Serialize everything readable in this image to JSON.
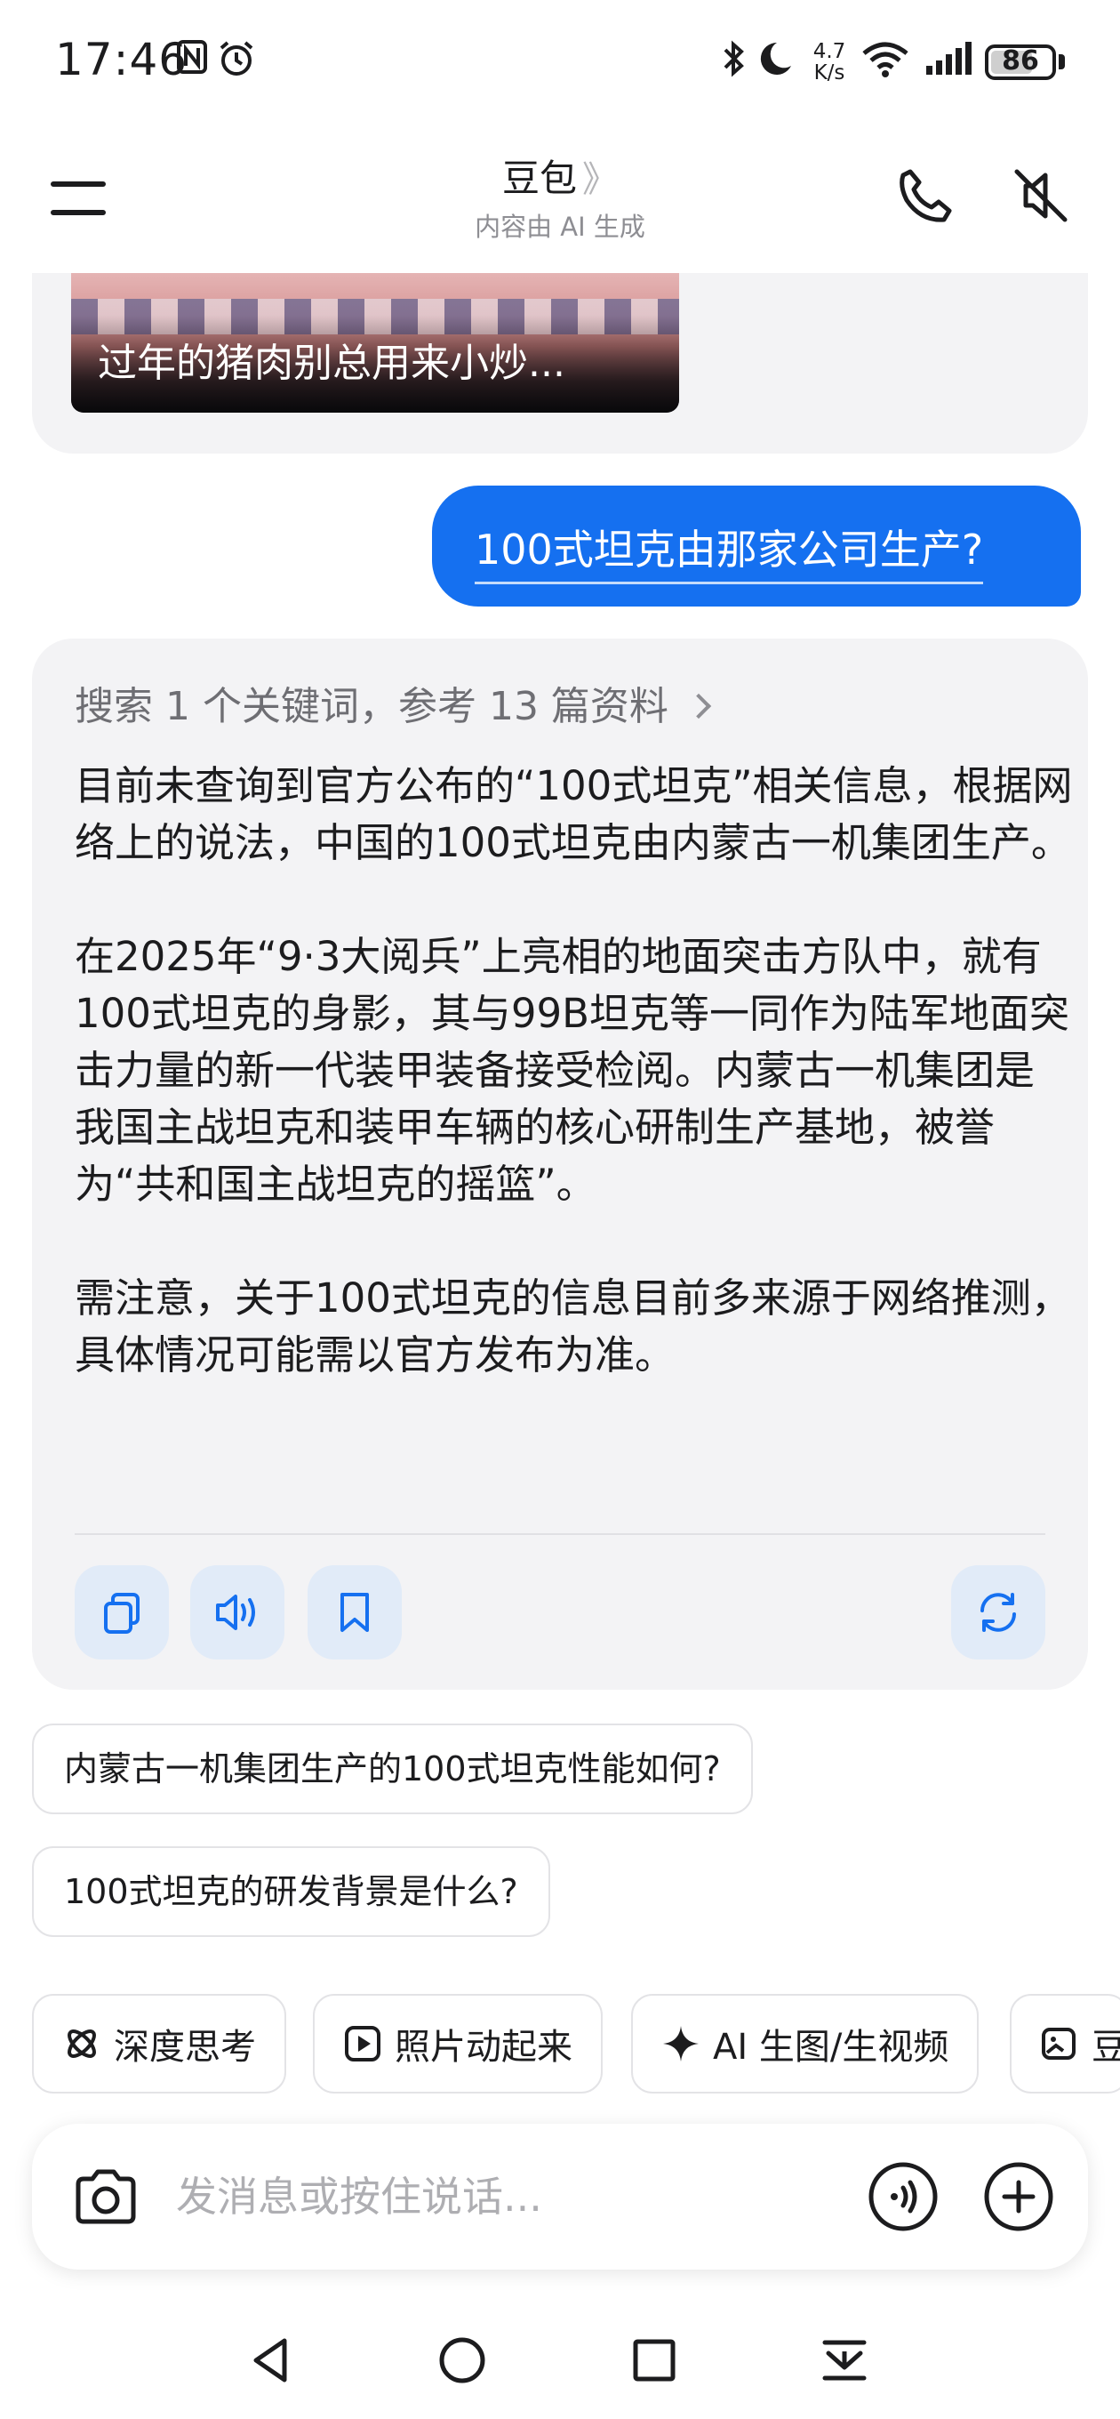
{
  "status_bar": {
    "time": "17:46",
    "speed_value": "4.7",
    "speed_unit": "K/s",
    "battery": "86",
    "battery_level": 0.86
  },
  "header": {
    "title": "豆包",
    "chevron": "》",
    "subtitle": "内容由 AI 生成"
  },
  "previous_message": {
    "thumbnail_caption": "过年的猪肉别总用来小炒..."
  },
  "user_message": "100式坦克由那家公司生产?",
  "answer": {
    "search_summary": "搜索 1 个关键词，参考 13 篇资料",
    "paragraphs": [
      "目前未查询到官方公布的“100式坦克”相关信息，根据网络上的说法，中国的100式坦克由内蒙古一机集团生产。",
      "在2025年“9·3大阅兵”上亮相的地面突击方队中，就有100式坦克的身影，其与99B坦克等一同作为陆军地面突击力量的新一代装甲装备接受检阅。内蒙古一机集团是我国主战坦克和装甲车辆的核心研制生产基地，被誉为“共和国主战坦克的摇篮”。",
      "需注意，关于100式坦克的信息目前多来源于网络推测，具体情况可能需以官方发布为准。"
    ],
    "actions": [
      "copy-icon",
      "speaker-icon",
      "bookmark-icon",
      "regenerate-icon"
    ]
  },
  "suggestions": [
    "内蒙古一机集团生产的100式坦克性能如何?",
    "100式坦克的研发背景是什么?"
  ],
  "feature_chips": [
    {
      "label": "深度思考",
      "icon": "atom-icon"
    },
    {
      "label": "照片动起来",
      "icon": "play-box-icon"
    },
    {
      "label": "AI 生图/生视频",
      "icon": "sparkle-icon"
    },
    {
      "label": "豆",
      "icon": "image-edit-icon"
    }
  ],
  "input": {
    "placeholder": "发消息或按住说话..."
  },
  "colors": {
    "accent": "#1570f0",
    "card_bg": "#f3f3f5",
    "action_bg": "#e1ebf8"
  }
}
